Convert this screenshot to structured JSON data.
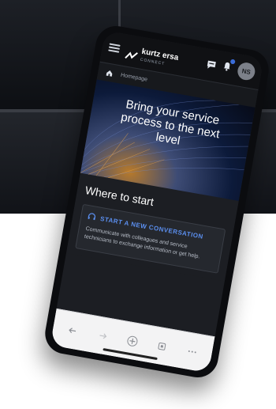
{
  "header": {
    "brand_name": "kurtz ersa",
    "brand_sub": "CONNECT",
    "avatar_initials": "NS"
  },
  "breadcrumb": {
    "label": "Homepage"
  },
  "hero": {
    "title_line1": "Bring your service",
    "title_line2": "process to the next",
    "title_line3": "level"
  },
  "section": {
    "title": "Where to start",
    "card_title": "START A NEW CONVERSATION",
    "card_text": "Communicate with colleagues and service technicians to exchange information or get help."
  },
  "bottom_nav": {
    "icons": [
      "arrow-left-icon",
      "arrow-right-icon",
      "plus-icon",
      "tabs-icon",
      "more-icon"
    ]
  },
  "colors": {
    "accent": "#5b8ff0",
    "topbar": "#101114",
    "screen_bg": "#1c1e23",
    "bottom_bar": "#f3f3f4"
  }
}
